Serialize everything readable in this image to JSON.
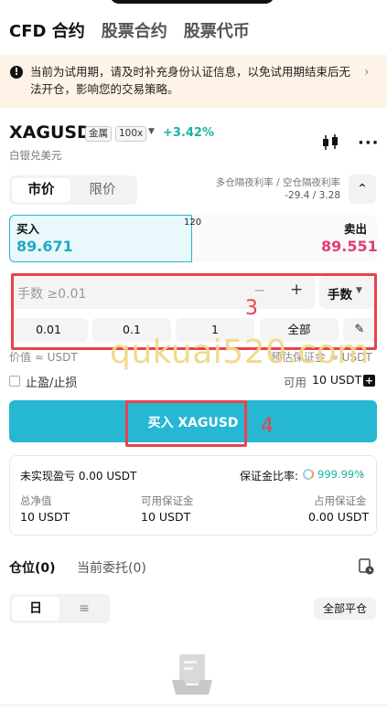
{
  "top_tabs": [
    "CFD 合约",
    "股票合约",
    "股票代币"
  ],
  "notice": {
    "icon": "exclamation-icon",
    "text": "当前为试用期，请及时补充身份认证信息，以免试用期结束后无法开仓，影响您的交易策略。"
  },
  "symbol": {
    "name": "XAGUSD",
    "category_badge": "金属",
    "leverage_badge": "100x",
    "change": "+3.42%",
    "subtitle": "白银兑美元"
  },
  "order_type": {
    "market": "市价",
    "limit": "限价",
    "selected": "market"
  },
  "overnight": {
    "label": "多仓隔夜利率 / 空仓隔夜利率",
    "value": "-29.4 / 3.28"
  },
  "quote": {
    "buy_label": "买入",
    "buy_price": "89.671",
    "sell_label": "卖出",
    "sell_price": "89.551",
    "spread": "120"
  },
  "quantity": {
    "placeholder": "手数 ≥0.01",
    "minus": "−",
    "plus": "+",
    "unit": "手数",
    "presets": [
      "0.01",
      "0.1",
      "1",
      "全部"
    ]
  },
  "annotations": [
    "3",
    "4"
  ],
  "value_label": "价值 ≈ USDT",
  "margin_label": "预估保证金 ≈ USDT",
  "watermark": "qukuai520.com",
  "tpsl_label": "止盈/止损",
  "available": {
    "label": "可用",
    "value": "10 USDT"
  },
  "buy_button": "买入 XAGUSD",
  "account": {
    "upnl": "未实现盈亏 0.00 USDT",
    "margin_ratio_label": "保证金比率:",
    "margin_ratio": "999.99%",
    "equity_label": "总净值",
    "equity_value": "10 USDT",
    "available_margin_label": "可用保证金",
    "available_margin_value": "10 USDT",
    "used_margin_label": "占用保证金",
    "used_margin_value": "0.00 USDT"
  },
  "positions": {
    "tab_positions": "仓位(0)",
    "tab_orders": "当前委托(0)",
    "view_day": "日",
    "view_list": "≡",
    "close_all": "全部平仓"
  },
  "colors": {
    "accent": "#26b7d3",
    "buy_price": "#21a9c4",
    "sell_price": "#e33c79",
    "change_up": "#19b3a3",
    "annotation": "#e8434c",
    "notice_bg": "#fdf3e6"
  }
}
